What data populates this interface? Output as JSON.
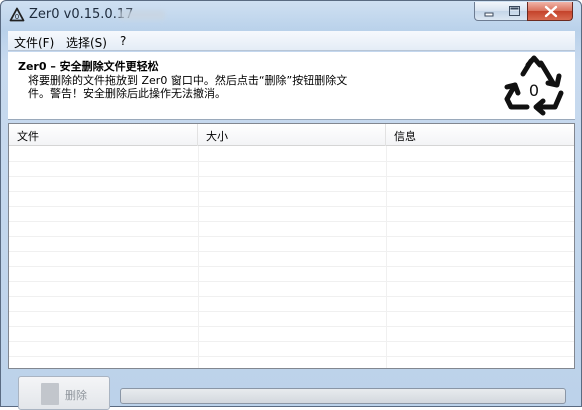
{
  "window": {
    "title": "Zer0 v0.15.0.17"
  },
  "menu": {
    "file": "文件(F)",
    "select": "选择(S)",
    "help": "?"
  },
  "header": {
    "title": "Zer0 – 安全删除文件更轻松",
    "description": "将要删除的文件拖放到 Zer0 窗口中。然后点击“删除”按钮删除文件。警告！安全删除后此操作无法撤消。",
    "logo_text": "0"
  },
  "list": {
    "columns": [
      "文件",
      "大小",
      "信息"
    ],
    "rows": []
  },
  "footer": {
    "delete_label": "删除",
    "progress": 0
  },
  "colors": {
    "title_bar": "#b9d1ea",
    "close_button": "#c4422a",
    "list_border": "#828790"
  }
}
